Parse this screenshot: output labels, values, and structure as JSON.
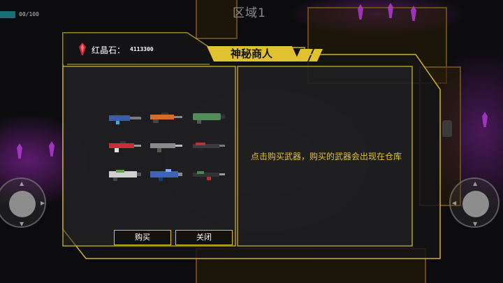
{
  "hud": {
    "hp_text": "00/100",
    "zone_title": "区域1"
  },
  "shop": {
    "title": "神秘商人",
    "currency_label": "红晶石：",
    "currency_value": "4113300",
    "description": "点击购买武器，购买的武器会出现在仓库",
    "buy_label": "购买",
    "close_label": "关闭",
    "weapons": [
      {
        "name": "weapon-1",
        "icon": "blue-smg-icon"
      },
      {
        "name": "weapon-2",
        "icon": "orange-rifle-icon"
      },
      {
        "name": "weapon-3",
        "icon": "green-launcher-icon"
      },
      {
        "name": "weapon-4",
        "icon": "red-rifle-icon"
      },
      {
        "name": "weapon-5",
        "icon": "gray-rifle-icon"
      },
      {
        "name": "weapon-6",
        "icon": "red-shotgun-icon"
      },
      {
        "name": "weapon-7",
        "icon": "green-cannon-icon"
      },
      {
        "name": "weapon-8",
        "icon": "blue-cannon-icon"
      },
      {
        "name": "weapon-9",
        "icon": "green-rifle-icon"
      }
    ]
  },
  "colors": {
    "accent_gold": "#e0c12f",
    "currency_red": "#d0283a",
    "description_text": "#e2c32b"
  }
}
